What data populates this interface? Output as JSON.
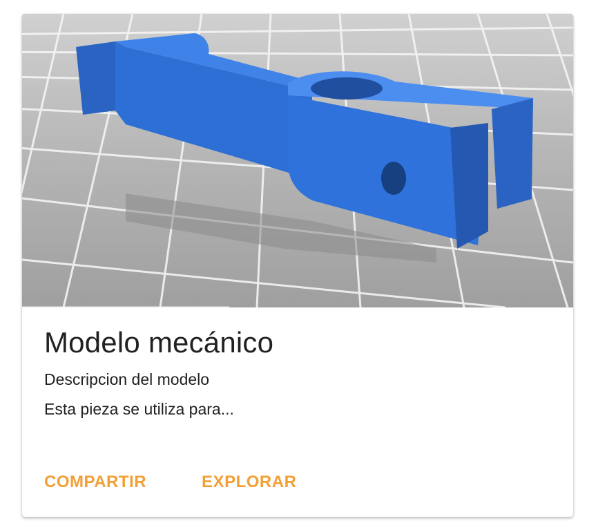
{
  "card": {
    "image_subject": "blue 3D printed mechanical part on grid",
    "title": "Modelo mecánico",
    "subtitle": "Descripcion del modelo",
    "body": "Esta pieza se utiliza para...",
    "actions": [
      {
        "label": "COMPARTIR"
      },
      {
        "label": "EXPLORAR"
      }
    ]
  },
  "colors": {
    "accent": "#f2a036",
    "text": "#212121",
    "model_blue": "#2e6fd6",
    "grid_background": "#a9a9a9"
  }
}
